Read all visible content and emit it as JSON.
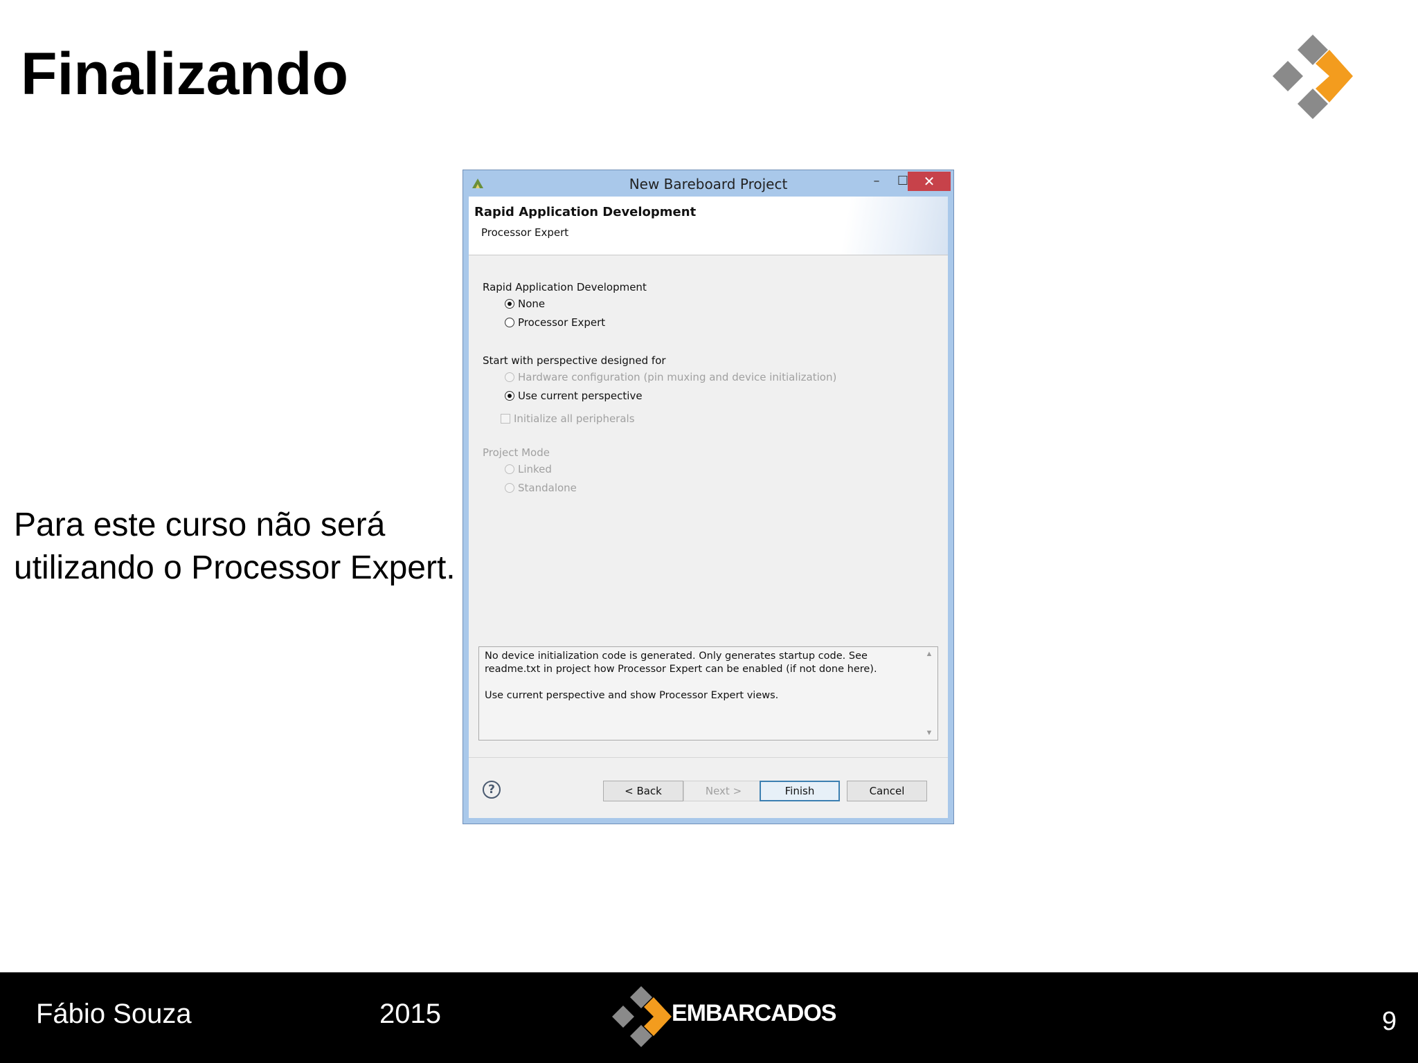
{
  "slide": {
    "title": "Finalizando",
    "body": "Para este curso não será utilizando o Processor Expert."
  },
  "dialog": {
    "window_title": "New Bareboard Project",
    "controls": {
      "minimize": "–",
      "maximize": "☐",
      "close": "✕"
    },
    "header_title": "Rapid Application Development",
    "header_subtitle": "Processor Expert",
    "rad_group_label": "Rapid Application Development",
    "rad_options": [
      {
        "label": "None",
        "selected": true
      },
      {
        "label": "Processor Expert",
        "selected": false
      }
    ],
    "perspective_label": "Start with perspective designed for",
    "perspective_options": [
      {
        "label": "Hardware configuration (pin muxing and device initialization)",
        "selected": false,
        "enabled": false
      },
      {
        "label": "Use current perspective",
        "selected": true,
        "enabled": true
      }
    ],
    "init_checkbox": {
      "label": "Initialize all peripherals",
      "checked": false,
      "enabled": false
    },
    "project_mode_label": "Project Mode",
    "project_mode_options": [
      {
        "label": "Linked",
        "enabled": false
      },
      {
        "label": "Standalone",
        "enabled": false
      }
    ],
    "description": "No device initialization code is generated. Only generates startup code. See readme.txt in project how Processor Expert can be enabled (if not done here).\n\nUse current perspective and show Processor Expert views.",
    "buttons": {
      "help": "?",
      "back": "< Back",
      "next": "Next >",
      "finish": "Finish",
      "cancel": "Cancel"
    }
  },
  "footer": {
    "author": "Fábio Souza",
    "year": "2015",
    "brand": "EMBARCADOS",
    "page_number": "9"
  },
  "colors": {
    "brand_orange": "#f39c1e",
    "brand_gray": "#8a8a8a",
    "titlebar": "#a9c8ea",
    "close_button": "#c7424a",
    "footer_bg": "#000000"
  }
}
